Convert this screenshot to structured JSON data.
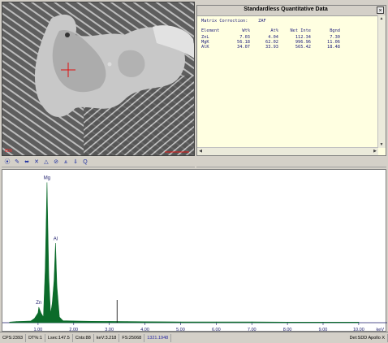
{
  "sem": {
    "scale_tag": "EDX"
  },
  "quant_window": {
    "title": "Standardless Quantitative Data",
    "close_glyph": "×",
    "matrix_line": "Matrix Correction:    ZAF",
    "headers": [
      "Element",
      "Wt%",
      "At%",
      "Net Inte",
      "Bgnd"
    ],
    "rows": [
      [
        "ZnL",
        "7.03",
        "4.04",
        "112.34",
        "7.30"
      ],
      [
        "MgK",
        "56.18",
        "62.02",
        "996.96",
        "11.06"
      ],
      [
        "AlK",
        "34.07",
        "33.93",
        "565.42",
        "18.48"
      ]
    ]
  },
  "toolbar": {
    "icons": [
      "zoom-in-icon",
      "tool-icon",
      "arrows-icon",
      "expand-icon",
      "triangle-icon",
      "peak-icon",
      "label-icon",
      "marker-icon",
      "zoom-icon"
    ],
    "glyphs": [
      "⦿",
      "✎",
      "⬌",
      "✕",
      "△",
      "⊘",
      "⩓",
      "⇓",
      "Q"
    ]
  },
  "spectrum": {
    "peak_labels": {
      "mg": "Mg",
      "al": "Al",
      "zn": "Zn"
    },
    "ticks": [
      "1.00",
      "2.00",
      "3.00",
      "4.00",
      "5.00",
      "6.00",
      "7.00",
      "8.00",
      "9.00",
      "10.00"
    ],
    "unit": "keV",
    "accent": "#0b6b2a"
  },
  "chart_data": {
    "type": "line",
    "xlabel": "keV",
    "xlim": [
      0,
      10.8
    ],
    "ylim": [
      0,
      1000
    ],
    "x": [
      0.2,
      0.4,
      0.6,
      0.8,
      0.9,
      1.0,
      1.02,
      1.08,
      1.15,
      1.2,
      1.25,
      1.3,
      1.35,
      1.4,
      1.45,
      1.49,
      1.53,
      1.6,
      1.7,
      2.0,
      2.5,
      3.0,
      3.5,
      4.0,
      5.0,
      6.0,
      7.0,
      8.0,
      9.0,
      10.0
    ],
    "series": [
      {
        "values": [
          4,
          8,
          10,
          12,
          30,
          70,
          110,
          70,
          40,
          380,
          996,
          330,
          60,
          140,
          300,
          565,
          260,
          40,
          14,
          12,
          10,
          9,
          8,
          7,
          6,
          5,
          5,
          4,
          4,
          4
        ]
      }
    ],
    "peaks": [
      {
        "label": "Zn",
        "x": 1.02
      },
      {
        "label": "Mg",
        "x": 1.25
      },
      {
        "label": "Al",
        "x": 1.49
      }
    ]
  },
  "status": {
    "cps": "CPS:2393",
    "dt": "DT%:1",
    "lsec": "Lsec:147.5",
    "cnts": "Cnts:88",
    "kev": "keV:3.218",
    "fs": "FS:25068",
    "counter": "1321.1948",
    "det": "Det:SDD Apollo X"
  }
}
